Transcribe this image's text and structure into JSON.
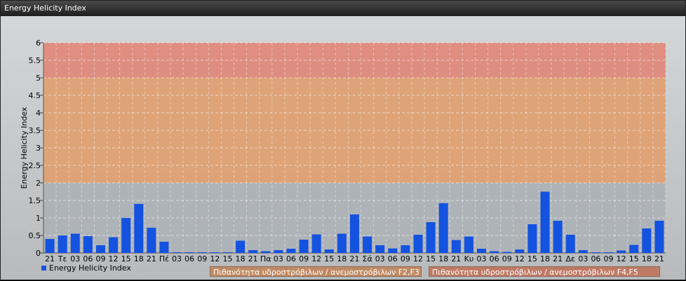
{
  "window": {
    "title": "Energy Helicity Index"
  },
  "chart_data": {
    "type": "bar",
    "ylabel": "Energy Helicity Index",
    "xlabel": "",
    "ylim": [
      0,
      6
    ],
    "yticks": [
      "0",
      "0.5",
      "1",
      "1.5",
      "2",
      "2.5",
      "3",
      "3.5",
      "4",
      "4.5",
      "5",
      "5.5",
      "6"
    ],
    "grid": true,
    "legend_position": "bottom-left",
    "categories": [
      "21",
      "Τε",
      "03",
      "06",
      "09",
      "12",
      "15",
      "18",
      "21",
      "Πέ",
      "03",
      "06",
      "09",
      "12",
      "15",
      "18",
      "21",
      "Πα",
      "03",
      "06",
      "09",
      "12",
      "15",
      "18",
      "21",
      "Σά",
      "03",
      "06",
      "09",
      "12",
      "15",
      "18",
      "21",
      "Κυ",
      "03",
      "06",
      "09",
      "12",
      "15",
      "18",
      "21",
      "Δε",
      "03",
      "06",
      "09",
      "12",
      "15",
      "18",
      "21"
    ],
    "series": [
      {
        "name": "Energy Helicity Index",
        "color": "#1452e0",
        "values": [
          0.4,
          0.5,
          0.55,
          0.48,
          0.22,
          0.45,
          1.0,
          1.4,
          0.72,
          0.32,
          0.02,
          0.02,
          0.02,
          0.02,
          0.02,
          0.35,
          0.08,
          0.05,
          0.08,
          0.12,
          0.38,
          0.53,
          0.1,
          0.55,
          1.1,
          0.47,
          0.22,
          0.13,
          0.22,
          0.52,
          0.88,
          1.42,
          0.37,
          0.47,
          0.12,
          0.05,
          0.03,
          0.1,
          0.82,
          1.75,
          0.92,
          0.52,
          0.08,
          0.02,
          0.02,
          0.07,
          0.23,
          0.7,
          0.92
        ]
      }
    ],
    "bands": [
      {
        "from": 2,
        "to": 5,
        "color": "#e0a070"
      },
      {
        "from": 5,
        "to": 6,
        "color": "#e08878"
      }
    ],
    "legend_boxes": [
      {
        "label": "Πιθανότητα υδροστρόβιλων / ανεμοστρόβιλων F2,F3",
        "color": "#c08a64"
      },
      {
        "label": "Πιθανότητα υδροστρόβιλων / ανεμοστρόβιλων F4,F5",
        "color": "#bf7a66"
      }
    ]
  }
}
